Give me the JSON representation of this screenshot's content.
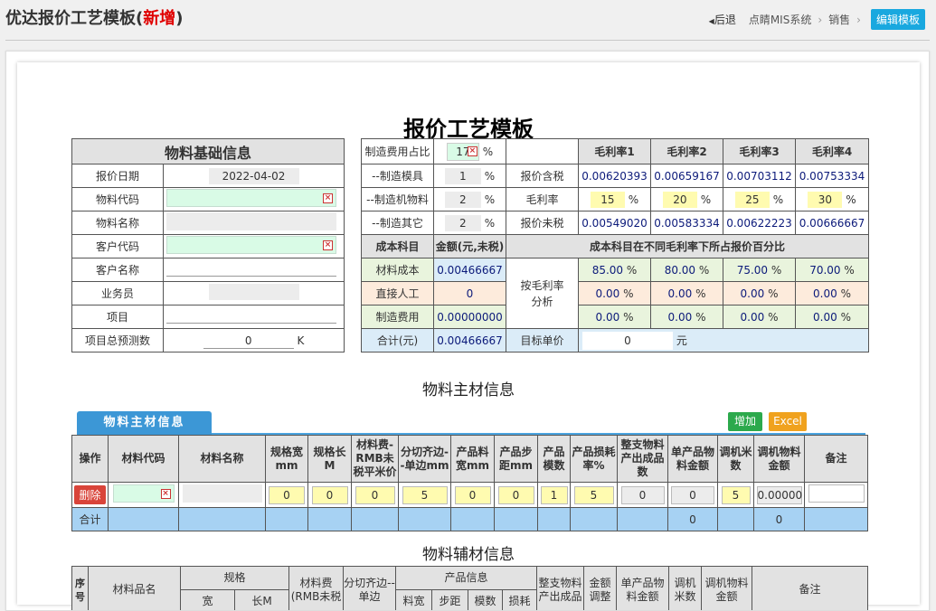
{
  "header": {
    "title_main": "优达报价工艺模板(",
    "title_red": "新增",
    "title_close": ")",
    "back": "后退",
    "crumb1": "点睛MIS系统",
    "crumb2": "销售",
    "edit_btn": "编辑模板"
  },
  "doc_title": "报价工艺模板",
  "basic": {
    "title": "物料基础信息",
    "rows": [
      {
        "label": "报价日期",
        "value": "2022-04-02"
      },
      {
        "label": "物料代码",
        "value": ""
      },
      {
        "label": "物料名称",
        "value": ""
      },
      {
        "label": "客户代码",
        "value": ""
      },
      {
        "label": "客户名称",
        "value": ""
      },
      {
        "label": "业务员",
        "value": ""
      },
      {
        "label": "项目",
        "value": ""
      },
      {
        "label": "项目总预测数",
        "value": "0",
        "unit": "K"
      }
    ]
  },
  "cost": {
    "mfg_ratio_label": "制造费用占比",
    "mfg_ratio_value": "17",
    "pct": "%",
    "mold_label": "--制造模具",
    "mold_value": "1",
    "mach_label": "--制造机物料",
    "mach_value": "2",
    "other_label": "--制造其它",
    "other_value": "2",
    "gm_headers": [
      "毛利率1",
      "毛利率2",
      "毛利率3",
      "毛利率4"
    ],
    "quote_tax_label": "报价含税",
    "quote_tax": [
      "0.00620393",
      "0.00659167",
      "0.00703112",
      "0.00753334"
    ],
    "gm_label": "毛利率",
    "gm_values": [
      "15",
      "20",
      "25",
      "30"
    ],
    "quote_notax_label": "报价未税",
    "quote_notax": [
      "0.00549020",
      "0.00583334",
      "0.00622223",
      "0.00666667"
    ],
    "cost_item": "成本科目",
    "amount_head": "金额(元,未税)",
    "pct_head": "成本科目在不同毛利率下所占报价百分比",
    "material_label": "材料成本",
    "material_value": "0.00466667",
    "labor_label": "直接人工",
    "labor_value": "0",
    "mfg_label": "制造费用",
    "mfg_value": "0.00000000",
    "analysis_label": "按毛利率分析",
    "material_pcts": [
      "85.00",
      "80.00",
      "75.00",
      "70.00"
    ],
    "labor_pcts": [
      "0.00",
      "0.00",
      "0.00",
      "0.00"
    ],
    "mfg_pcts": [
      "0.00",
      "0.00",
      "0.00",
      "0.00"
    ],
    "total_label": "合计(元)",
    "total_value": "0.00466667",
    "target_label": "目标单价",
    "target_value": "0",
    "target_unit": "元"
  },
  "main_material": {
    "section_title": "物料主材信息",
    "tab": "物料主材信息",
    "add": "增加",
    "excel": "Excel",
    "headers": [
      "操作",
      "材料代码",
      "材料名称",
      "规格宽mm",
      "规格长M",
      "材料费-RMB未税平米价",
      "分切齐边--单边mm",
      "产品料宽mm",
      "产品步距mm",
      "产品模数",
      "产品损耗率%",
      "整支物料产出成品数",
      "单产品物料金额",
      "调机米数",
      "调机物料金额",
      "备注"
    ],
    "row": {
      "delete": "删除",
      "code": "",
      "name": "",
      "w": "0",
      "l": "0",
      "price": "0",
      "trim": "5",
      "pw": "0",
      "step": "0",
      "mods": "1",
      "loss": "5",
      "qty": "0",
      "unit_amt": "0",
      "adj_m": "5",
      "adj_amt": "0.00000",
      "remark": ""
    },
    "sum_label": "合计",
    "sum_unit_amt": "0",
    "sum_adj_amt": "0"
  },
  "aux_material": {
    "section_title": "物料辅材信息",
    "h_seq": "序号",
    "h_name": "材料品名",
    "h_spec": "规格",
    "h_spec_w": "宽",
    "h_spec_l": "长M",
    "h_price": "材料费(RMB未税",
    "h_trim": "分切齐边--单边",
    "h_prod": "产品信息",
    "h_pw": "料宽",
    "h_step": "步距",
    "h_mods": "模数",
    "h_loss": "损耗",
    "h_qty": "整支物料产出成品",
    "h_adj": "金额调整",
    "h_unit": "单产品物料金额",
    "h_adjm": "调机米数",
    "h_adjamt": "调机物料金额",
    "h_remark": "备注"
  }
}
